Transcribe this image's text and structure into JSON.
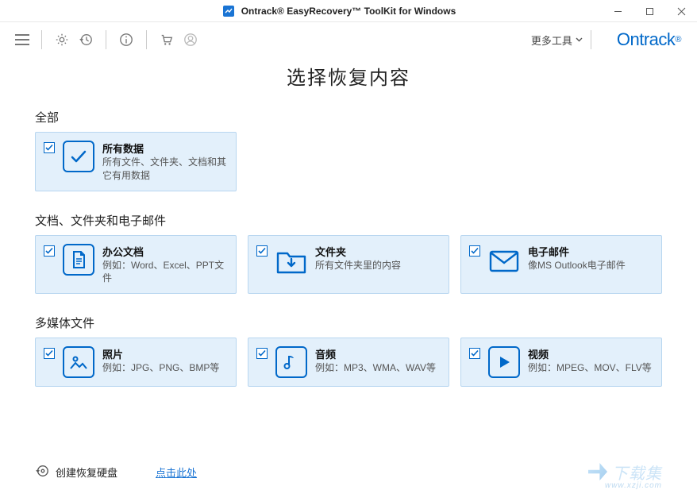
{
  "window": {
    "title": "Ontrack® EasyRecovery™ ToolKit for Windows"
  },
  "toolbar": {
    "more_tools": "更多工具",
    "brand": "Ontrack"
  },
  "page": {
    "title": "选择恢复内容"
  },
  "sections": {
    "all": {
      "label": "全部",
      "card": {
        "title": "所有数据",
        "desc": "所有文件、文件夹、文档和其它有用数据"
      }
    },
    "docs": {
      "label": "文档、文件夹和电子邮件",
      "office": {
        "title": "办公文档",
        "desc": "例如：Word、Excel、PPT文件"
      },
      "folder": {
        "title": "文件夹",
        "desc": "所有文件夹里的内容"
      },
      "email": {
        "title": "电子邮件",
        "desc": "像MS Outlook电子邮件"
      }
    },
    "media": {
      "label": "多媒体文件",
      "photo": {
        "title": "照片",
        "desc": "例如：JPG、PNG、BMP等"
      },
      "audio": {
        "title": "音频",
        "desc": "例如：MP3、WMA、WAV等"
      },
      "video": {
        "title": "视频",
        "desc": "例如：MPEG、MOV、FLV等"
      }
    }
  },
  "footer": {
    "create_disk": "创建恢复硬盘",
    "link": "点击此处",
    "watermark": "下载集",
    "watermark_sub": "www.xzji.com"
  },
  "colors": {
    "accent": "#0068c9",
    "card_bg": "#e3f0fb",
    "card_border": "#b8d6f0"
  }
}
